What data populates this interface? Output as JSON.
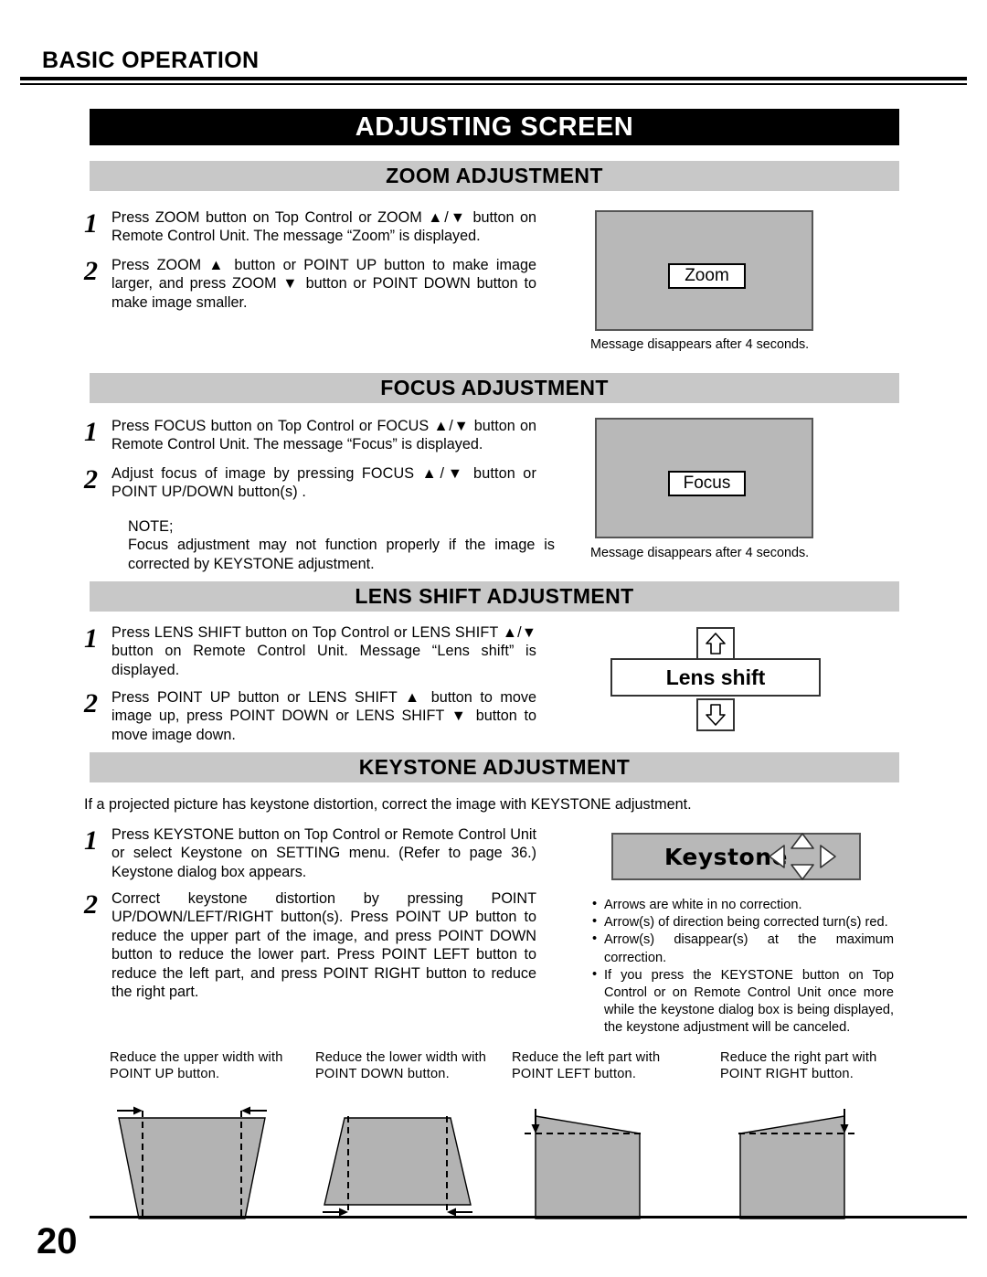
{
  "running_head": "BASIC OPERATION",
  "page_title": "ADJUSTING SCREEN",
  "page_number": "20",
  "colors": {
    "title_bar_bg": "#000000",
    "section_bar_bg": "#c8c8c8",
    "screen_grey": "#b8b8b8",
    "shape_grey": "#b3b3b3"
  },
  "sections": {
    "zoom": {
      "heading": "ZOOM ADJUSTMENT",
      "steps": [
        {
          "num": "1",
          "text": "Press ZOOM button on Top Control or ZOOM ▲/▼ button on Remote Control Unit.  The message “Zoom” is displayed."
        },
        {
          "num": "2",
          "text": "Press ZOOM ▲ button or POINT UP button to make image larger, and press ZOOM ▼ button or POINT DOWN button to make image smaller."
        }
      ],
      "dialog": {
        "message": "Zoom",
        "caption": "Message disappears after 4 seconds."
      }
    },
    "focus": {
      "heading": "FOCUS ADJUSTMENT",
      "steps": [
        {
          "num": "1",
          "text": "Press FOCUS button on Top Control or FOCUS ▲/▼ button on Remote Control Unit.  The message “Focus” is displayed."
        },
        {
          "num": "2",
          "text": "Adjust focus of image by pressing FOCUS ▲/▼  button or POINT UP/DOWN button(s) ."
        }
      ],
      "note_label": "NOTE;",
      "note_text": "Focus adjustment may not function properly if the image is corrected by KEYSTONE adjustment.",
      "dialog": {
        "message": "Focus",
        "caption": "Message disappears after 4 seconds."
      }
    },
    "lens_shift": {
      "heading": "LENS SHIFT ADJUSTMENT",
      "steps": [
        {
          "num": "1",
          "text": "Press LENS SHIFT button on Top Control or LENS SHIFT ▲/▼ button on Remote Control Unit. Message “Lens shift” is displayed."
        },
        {
          "num": "2",
          "text": "Press POINT UP button or LENS SHIFT ▲ button to move image up, press POINT DOWN or LENS SHIFT ▼ button to move image down."
        }
      ],
      "dialog": {
        "message": "Lens shift"
      }
    },
    "keystone": {
      "heading": "KEYSTONE ADJUSTMENT",
      "intro": "If a projected picture has keystone distortion, correct the image with KEYSTONE adjustment.",
      "steps": [
        {
          "num": "1",
          "text": "Press KEYSTONE button on Top Control or Remote Control Unit or select Keystone on SETTING menu.  (Refer to page 36.) Keystone dialog box appears."
        },
        {
          "num": "2",
          "text": "Correct keystone distortion by pressing POINT UP/DOWN/LEFT/RIGHT button(s).  Press POINT UP button to reduce the upper part of the image, and press POINT DOWN button to reduce the lower part.  Press POINT LEFT button to reduce the left part, and press POINT RIGHT button to reduce the right part."
        }
      ],
      "dialog": {
        "message": "Keystone"
      },
      "bullets": [
        "Arrows are white in no correction.",
        "Arrow(s) of direction being corrected turn(s) red.",
        "Arrow(s) disappear(s) at the maximum correction.",
        "If you press the KEYSTONE button on Top Control or on Remote Control Unit once more while the keystone dialog box is being displayed, the keystone adjustment will be canceled."
      ],
      "diagrams": [
        {
          "caption": "Reduce the upper width with POINT UP button."
        },
        {
          "caption": "Reduce the lower width with POINT DOWN button."
        },
        {
          "caption": "Reduce the left part with POINT LEFT button."
        },
        {
          "caption": "Reduce the right part with POINT RIGHT button."
        }
      ]
    }
  }
}
